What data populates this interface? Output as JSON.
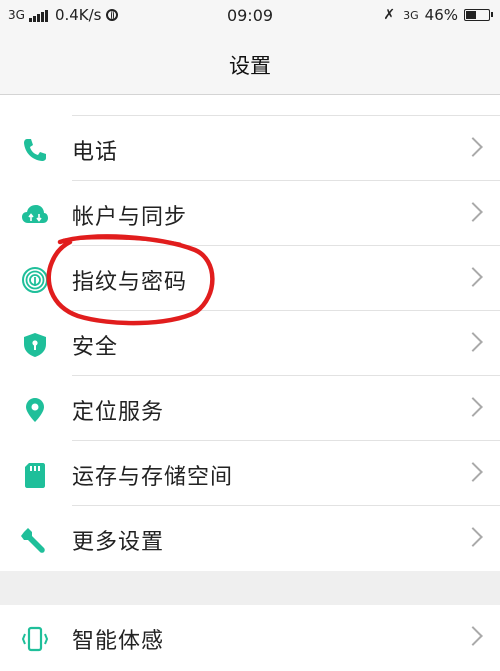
{
  "status_bar": {
    "network_left": "3G",
    "speed": "0.4K/s",
    "time": "09:09",
    "network_right": "3G",
    "battery": "46%",
    "battery_level": 0.46
  },
  "header": {
    "title": "设置"
  },
  "accent_color": "#1fbf9a",
  "settings": [
    {
      "icon": "phone-icon",
      "label": "电话"
    },
    {
      "icon": "cloud-sync-icon",
      "label": "帐户与同步"
    },
    {
      "icon": "fingerprint-icon",
      "label": "指纹与密码"
    },
    {
      "icon": "shield-icon",
      "label": "安全"
    },
    {
      "icon": "location-pin-icon",
      "label": "定位服务"
    },
    {
      "icon": "sd-card-icon",
      "label": "运存与存储空间"
    },
    {
      "icon": "wrench-icon",
      "label": "更多设置"
    }
  ],
  "settings2": [
    {
      "icon": "smart-gesture-icon",
      "label": "智能体感"
    }
  ]
}
